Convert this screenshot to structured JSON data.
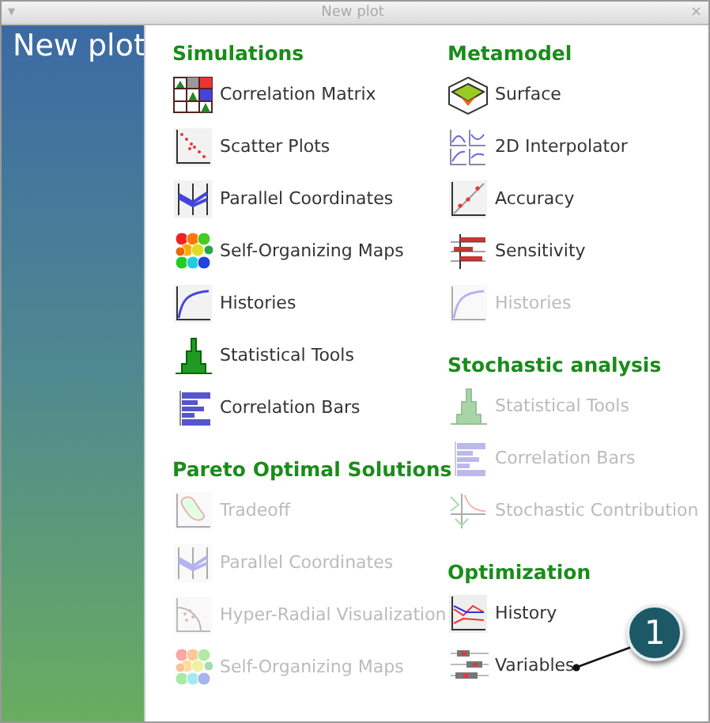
{
  "title_bar": {
    "menu_glyph": "▾",
    "title": "New plot",
    "close_glyph": "×"
  },
  "banner": {
    "title": "New plot"
  },
  "columns": [
    {
      "sections": [
        {
          "title": "Simulations",
          "items": [
            {
              "label": "Correlation Matrix",
              "disabled": false
            },
            {
              "label": "Scatter Plots",
              "disabled": false
            },
            {
              "label": "Parallel Coordinates",
              "disabled": false
            },
            {
              "label": "Self-Organizing Maps",
              "disabled": false
            },
            {
              "label": "Histories",
              "disabled": false
            },
            {
              "label": "Statistical Tools",
              "disabled": false
            },
            {
              "label": "Correlation Bars",
              "disabled": false
            }
          ]
        },
        {
          "title": "Pareto Optimal Solutions",
          "items": [
            {
              "label": "Tradeoff",
              "disabled": true
            },
            {
              "label": "Parallel Coordinates",
              "disabled": true
            },
            {
              "label": "Hyper-Radial Visualization",
              "disabled": true
            },
            {
              "label": "Self-Organizing Maps",
              "disabled": true
            }
          ]
        }
      ]
    },
    {
      "sections": [
        {
          "title": "Metamodel",
          "items": [
            {
              "label": "Surface",
              "disabled": false
            },
            {
              "label": "2D Interpolator",
              "disabled": false
            },
            {
              "label": "Accuracy",
              "disabled": false
            },
            {
              "label": "Sensitivity",
              "disabled": false
            },
            {
              "label": "Histories",
              "disabled": true
            }
          ]
        },
        {
          "title": "Stochastic analysis",
          "items": [
            {
              "label": "Statistical Tools",
              "disabled": true
            },
            {
              "label": "Correlation Bars",
              "disabled": true
            },
            {
              "label": "Stochastic Contribution",
              "disabled": true
            }
          ]
        },
        {
          "title": "Optimization",
          "items": [
            {
              "label": "History",
              "disabled": false
            },
            {
              "label": "Variables",
              "disabled": false
            }
          ]
        }
      ]
    }
  ],
  "callout": {
    "label": "1"
  }
}
